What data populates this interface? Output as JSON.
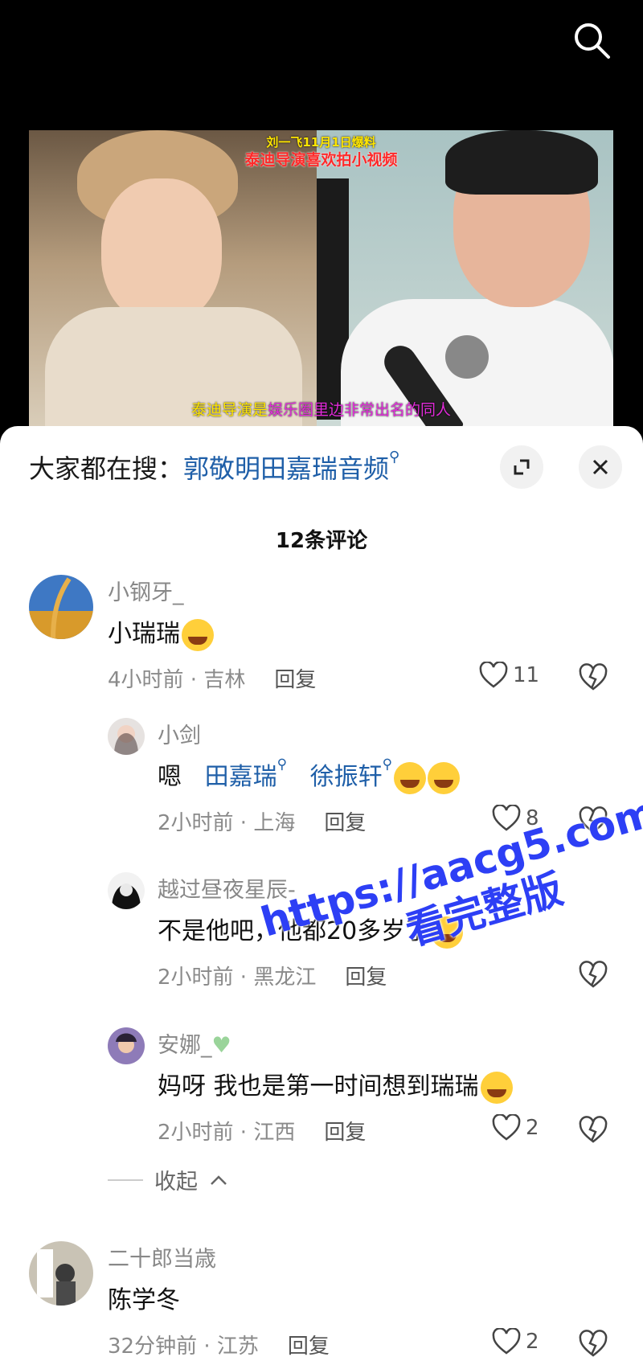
{
  "video": {
    "caption_top_1": "刘一飞11月1日爆料",
    "caption_top_2": "泰迪导演喜欢拍小视频",
    "caption_bottom_a": "泰迪导演是",
    "caption_bottom_b": "娱乐圈里边非常出名的同人"
  },
  "sheet": {
    "search_prefix": "大家都在搜：",
    "search_link": "郭敬明田嘉瑞音频",
    "comment_count": "12条评论",
    "collapse_label": "收起"
  },
  "comments": [
    {
      "user": "小钢牙_",
      "text": "小瑞瑞",
      "time_loc": "4小时前 · 吉林",
      "reply": "回复",
      "likes": "11"
    },
    {
      "user": "小剑",
      "text_prefix": "嗯",
      "link1": "田嘉瑞",
      "link2": "徐振轩",
      "time_loc": "2小时前 · 上海",
      "reply": "回复",
      "likes": "8"
    },
    {
      "user": "越过昼夜星辰-",
      "text": "不是他吧，他都20多岁了",
      "time_loc": "2小时前 · 黑龙江",
      "reply": "回复",
      "likes": ""
    },
    {
      "user": "安娜_",
      "text": "妈呀 我也是第一时间想到瑞瑞",
      "time_loc": "2小时前 · 江西",
      "reply": "回复",
      "likes": "2"
    },
    {
      "user": "二十郎当歳",
      "text": "陈学冬",
      "time_loc": "32分钟前 · 江苏",
      "reply": "回复",
      "likes": "2"
    }
  ],
  "watermark": {
    "line1": "https://aacg5.com",
    "line2": "看完整版"
  },
  "icons": [
    "search-icon",
    "expand-icon",
    "close-icon",
    "heart-icon",
    "dislike-heart-icon",
    "chevron-up-icon"
  ]
}
